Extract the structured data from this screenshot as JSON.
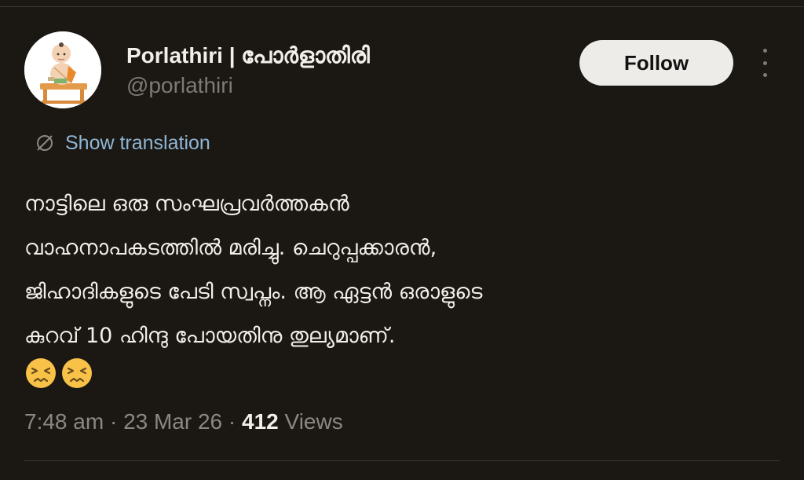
{
  "author": {
    "display_name": "Porlathiri | പോർളാതിരി",
    "handle": "@porlathiri",
    "avatar_icon": "cartoon-priest-avatar-icon"
  },
  "actions": {
    "follow_label": "Follow",
    "more_icon": "more-vertical-icon"
  },
  "translation": {
    "icon": "globe-icon",
    "label": "Show translation",
    "color": "#8fb6d6"
  },
  "tweet": {
    "lines": [
      "നാട്ടിലെ ഒരു സംഘപ്രവർത്തകൻ",
      "വാഹനാപകടത്തിൽ മരിച്ചു. ചെറുപ്പക്കാരൻ,",
      "ജിഹാദികളുടെ പേടി സ്വപ്നം. ആ ഏട്ടൻ ഒരാളുടെ",
      "കുറവ് 10 ഹിന്ദു പോയതിനു തുല്യമാണ്."
    ],
    "emojis": [
      "persevering-face-emoji",
      "persevering-face-emoji"
    ]
  },
  "meta": {
    "time": "7:48 am",
    "separator": " · ",
    "date": "23 Mar 26",
    "views_count": "412",
    "views_label": "Views"
  },
  "colors": {
    "background": "#1b1712",
    "text": "#f2efea",
    "muted": "#8c877f",
    "follow_bg": "#eeece8"
  }
}
